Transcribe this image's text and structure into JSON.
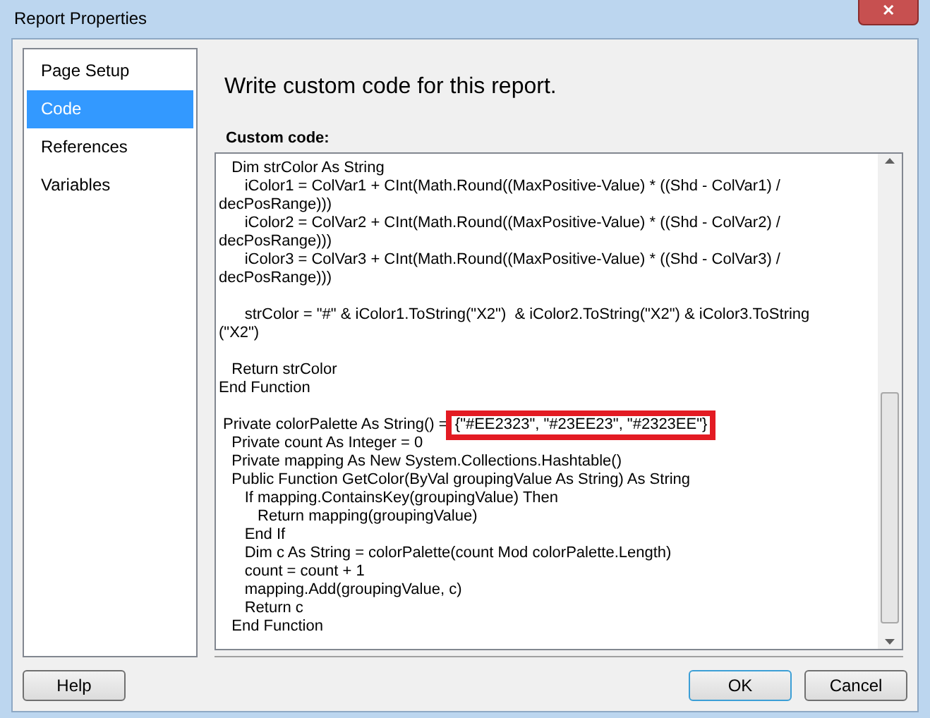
{
  "window": {
    "title": "Report Properties",
    "close_glyph": "✕"
  },
  "sidebar": {
    "items": [
      {
        "label": "Page Setup",
        "selected": false
      },
      {
        "label": "Code",
        "selected": true
      },
      {
        "label": "References",
        "selected": false
      },
      {
        "label": "Variables",
        "selected": false
      }
    ]
  },
  "heading": "Write custom code for this report.",
  "code_label": "Custom code:",
  "code_lines": [
    {
      "kind": "text",
      "text": "   Dim strColor As String"
    },
    {
      "kind": "text",
      "text": "      iColor1 = ColVar1 + CInt(Math.Round((MaxPositive-Value) * ((Shd - ColVar1) /"
    },
    {
      "kind": "text",
      "text": "decPosRange)))"
    },
    {
      "kind": "text",
      "text": "      iColor2 = ColVar2 + CInt(Math.Round((MaxPositive-Value) * ((Shd - ColVar2) /"
    },
    {
      "kind": "text",
      "text": "decPosRange)))"
    },
    {
      "kind": "text",
      "text": "      iColor3 = ColVar3 + CInt(Math.Round((MaxPositive-Value) * ((Shd - ColVar3) /"
    },
    {
      "kind": "text",
      "text": "decPosRange)))"
    },
    {
      "kind": "blank"
    },
    {
      "kind": "text",
      "text": "      strColor = \"#\" & iColor1.ToString(\"X2\")  & iColor2.ToString(\"X2\") & iColor3.ToString"
    },
    {
      "kind": "text",
      "text": "(\"X2\")"
    },
    {
      "kind": "blank"
    },
    {
      "kind": "text",
      "text": "   Return strColor"
    },
    {
      "kind": "text",
      "text": "End Function"
    },
    {
      "kind": "blank"
    },
    {
      "kind": "highlighted",
      "text": " Private colorPalette As String() = ",
      "highlight": "{\"#EE2323\", \"#23EE23\", \"#2323EE\"}"
    },
    {
      "kind": "text",
      "text": "   Private count As Integer = 0"
    },
    {
      "kind": "text",
      "text": "   Private mapping As New System.Collections.Hashtable()"
    },
    {
      "kind": "text",
      "text": "   Public Function GetColor(ByVal groupingValue As String) As String"
    },
    {
      "kind": "text",
      "text": "      If mapping.ContainsKey(groupingValue) Then"
    },
    {
      "kind": "text",
      "text": "         Return mapping(groupingValue)"
    },
    {
      "kind": "text",
      "text": "      End If"
    },
    {
      "kind": "text",
      "text": "      Dim c As String = colorPalette(count Mod colorPalette.Length)"
    },
    {
      "kind": "text",
      "text": "      count = count + 1"
    },
    {
      "kind": "text",
      "text": "      mapping.Add(groupingValue, c)"
    },
    {
      "kind": "text",
      "text": "      Return c"
    },
    {
      "kind": "text",
      "text": "   End Function"
    }
  ],
  "buttons": {
    "help": "Help",
    "ok": "OK",
    "cancel": "Cancel"
  }
}
